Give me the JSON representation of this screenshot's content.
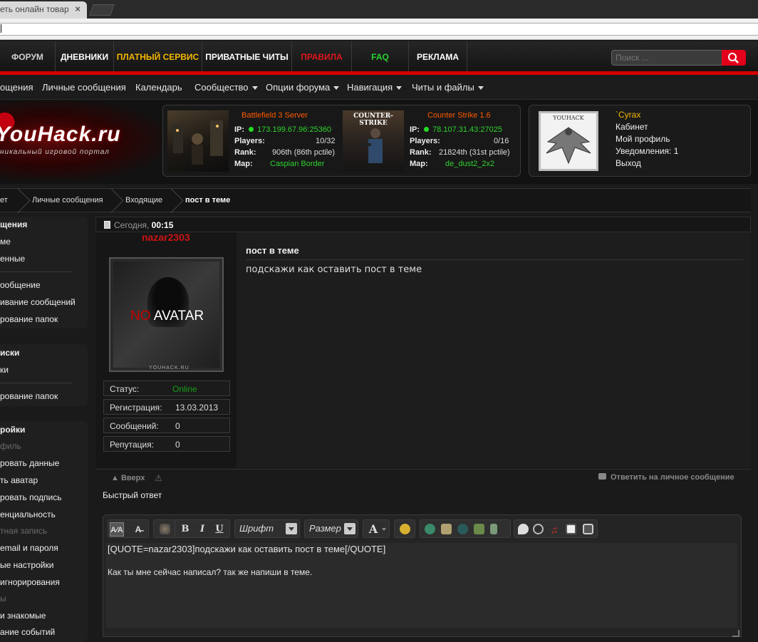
{
  "browser": {
    "tab_title": "еть онлайн товари",
    "tab_close": "×"
  },
  "nav_main": [
    {
      "label": "ФОРУМ",
      "color": "#cfcfcf"
    },
    {
      "label": "ДНЕВНИКИ",
      "color": "#ffffff"
    },
    {
      "label": "ПЛАТНЫЙ СЕРВИС",
      "color": "#f5b800"
    },
    {
      "label": "ПРИВАТНЫЕ ЧИТЫ",
      "color": "#ffffff"
    },
    {
      "label": "ПРАВИЛА",
      "color": "#e0151b"
    },
    {
      "label": "FAQ",
      "color": "#29d12f"
    },
    {
      "label": "РЕКЛАМА",
      "color": "#ffffff"
    }
  ],
  "search": {
    "placeholder": "Поиск ..."
  },
  "nav_sub": [
    {
      "label": "ощения",
      "dropdown": false
    },
    {
      "label": "Личные сообщения",
      "dropdown": false
    },
    {
      "label": "Календарь",
      "dropdown": false
    },
    {
      "label": "Сообщество",
      "dropdown": true
    },
    {
      "label": "Опции форума",
      "dropdown": true
    },
    {
      "label": "Навигация",
      "dropdown": true
    },
    {
      "label": "Читы и файлы",
      "dropdown": true
    }
  ],
  "logo": {
    "text": "YouHack.ru",
    "tagline": "никальный игровой портал"
  },
  "servers": [
    {
      "title": "Battlefield 3 Server",
      "image_label": "",
      "ip_label": "IP:",
      "ip": "173.199.67.96:25360",
      "players_label": "Players:",
      "players": "10/32",
      "rank_label": "Rank:",
      "rank": "906th (86th pctile)",
      "map_label": "Map:",
      "map": "Caspian Border"
    },
    {
      "title": "Counter Strike 1.6",
      "image_label": "COUNTER-STRIKE",
      "ip_label": "IP:",
      "ip": "78.107.31.43:27025",
      "players_label": "Players:",
      "players": "0/16",
      "rank_label": "Rank:",
      "rank": "21824th (31st pctile)",
      "map_label": "Map:",
      "map": "de_dust2_2x2"
    }
  ],
  "user": {
    "avatar_label": "YOUHACK",
    "name": "`Cyrax",
    "links": [
      "Кабинет",
      "Мой профиль",
      "Уведомления: 1",
      "Выход"
    ]
  },
  "breadcrumbs": [
    "ет",
    "Личные сообщения",
    "Входящие",
    "пост в теме"
  ],
  "sidebar": {
    "group1": {
      "title": "щения",
      "items": [
        "ме",
        "енные"
      ],
      "items2": [
        "ообщение",
        "ивание сообщений",
        "рование папок"
      ]
    },
    "group2": {
      "title": "иски",
      "items": [
        "ки",
        "рование папок"
      ]
    },
    "group3": {
      "title": "ройки",
      "items": [
        {
          "label": "филь",
          "muted": true
        },
        {
          "label": "ровать данные",
          "muted": false
        },
        {
          "label": "ть аватар",
          "muted": false
        },
        {
          "label": "ровать подпись",
          "muted": false
        },
        {
          "label": "енциальность",
          "muted": false
        },
        {
          "label": "тная запись",
          "muted": true
        },
        {
          "label": "email и пароля",
          "muted": false
        },
        {
          "label": "ые настройки",
          "muted": false
        },
        {
          "label": "игнорирования",
          "muted": false
        },
        {
          "label": "ы",
          "muted": true
        },
        {
          "label": "и знакомые",
          "muted": false
        },
        {
          "label": "ание событий",
          "muted": false
        }
      ]
    }
  },
  "post": {
    "date_label": "Сегодня,",
    "time": "00:15",
    "author": "nazar2303",
    "avatar_text_no": "NO",
    "avatar_text": " AVATAR",
    "avatar_watermark": "YOUHACK.RU",
    "stats": [
      {
        "label": "Статус:",
        "value": "Online",
        "color": "#1a9e1a"
      },
      {
        "label": "Регистрация:",
        "value": "13.03.2013",
        "color": "#dddddd"
      },
      {
        "label": "Сообщений:",
        "value": "0",
        "color": "#dddddd"
      },
      {
        "label": "Репутация:",
        "value": "0",
        "color": "#dddddd"
      }
    ],
    "title": "пост в теме",
    "text": "подскажи как оставить пост в теме"
  },
  "post_footer": {
    "up": "Вверх",
    "warn_icon": "⚠",
    "reply": "Ответить на личное сообщение"
  },
  "quick_reply": {
    "title": "Быстрый ответ",
    "font_label": "Шрифт",
    "size_label": "Размер",
    "color_label": "A",
    "line1": "[QUOTE=nazar2303]подскажи как оставить пост в теме[/QUOTE]",
    "line2": "Как ты мне сейчас написал? так же напиши в теме."
  }
}
